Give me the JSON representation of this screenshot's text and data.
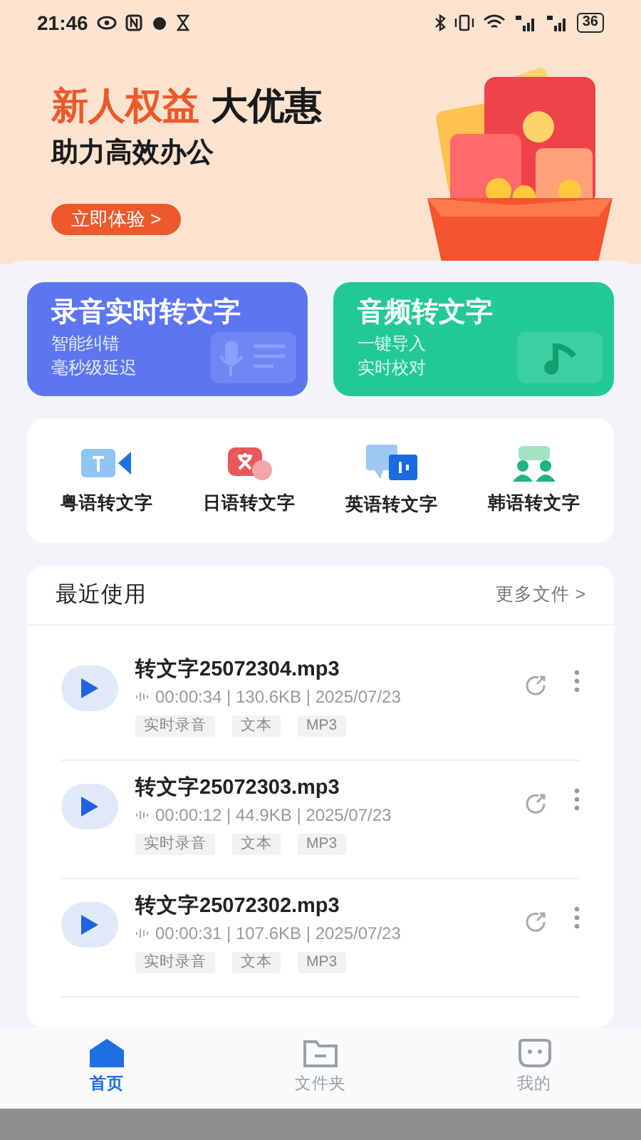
{
  "status_bar": {
    "time": "21:46",
    "battery": "36"
  },
  "banner": {
    "title_highlight": "新人权益",
    "title_rest": "大优惠",
    "subtitle": "助力高效办公",
    "button": "立即体验 >"
  },
  "feature_cards": [
    {
      "kind": "record",
      "title": "录音实时转文字",
      "lines": [
        "智能纠错",
        "毫秒级延迟"
      ]
    },
    {
      "kind": "audio",
      "title": "音频转文字",
      "lines": [
        "一键导入",
        "实时校对"
      ]
    }
  ],
  "languages": [
    {
      "kind": "video",
      "label": "粤语转文字"
    },
    {
      "kind": "translate",
      "label": "日语转文字"
    },
    {
      "kind": "english",
      "label": "英语转文字"
    },
    {
      "kind": "people",
      "label": "韩语转文字"
    }
  ],
  "recent": {
    "title": "最近使用",
    "more": "更多文件 >",
    "files": [
      {
        "name": "转文字25072304.mp3",
        "info": "00:00:34 | 130.6KB | 2025/07/23",
        "tags": [
          "实时录音",
          "文本",
          "MP3"
        ]
      },
      {
        "name": "转文字25072303.mp3",
        "info": "00:00:12 | 44.9KB | 2025/07/23",
        "tags": [
          "实时录音",
          "文本",
          "MP3"
        ]
      },
      {
        "name": "转文字25072302.mp3",
        "info": "00:00:31 | 107.6KB | 2025/07/23",
        "tags": [
          "实时录音",
          "文本",
          "MP3"
        ]
      }
    ]
  },
  "nav": [
    {
      "kind": "home",
      "label": "首页",
      "selected": true
    },
    {
      "kind": "folder",
      "label": "文件夹",
      "selected": false
    },
    {
      "kind": "me",
      "label": "我的",
      "selected": false
    }
  ]
}
